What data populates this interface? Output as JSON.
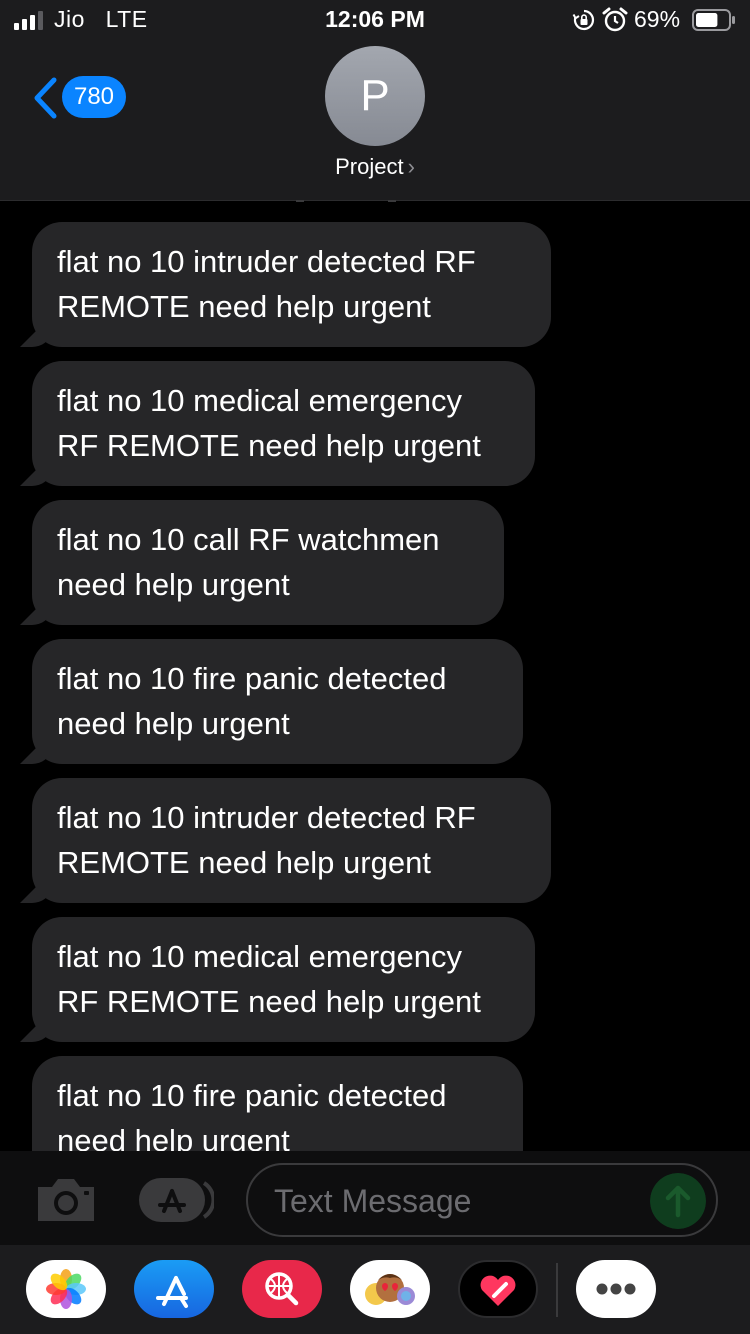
{
  "status_bar": {
    "carrier": "Jio",
    "network": "LTE",
    "time": "12:06 PM",
    "battery_percent": "69%",
    "battery_level": 0.69,
    "icons": [
      "signal-bars-icon",
      "rotation-lock-icon",
      "alarm-icon",
      "battery-icon"
    ]
  },
  "header": {
    "back_count": "780",
    "avatar_initial": "P",
    "contact_name": "Project",
    "chevron": "›"
  },
  "messages": [
    {
      "line1": "flat no 10 intruder detected RF",
      "line2": "REMOTE need help urgent"
    },
    {
      "line1": "flat no 10 medical emergency",
      "line2": "RF REMOTE need help urgent"
    },
    {
      "line1": "flat no 10 call RF watchmen",
      "line2": "need help urgent"
    },
    {
      "line1": "flat no 10 fire panic detected",
      "line2": "need help urgent"
    },
    {
      "line1": "flat no 10 intruder detected RF",
      "line2": "REMOTE need help urgent"
    },
    {
      "line1": "flat no 10 medical emergency",
      "line2": "RF REMOTE need help urgent"
    },
    {
      "line1": "flat no 10 fire panic detected",
      "line2": "need help urgent"
    }
  ],
  "input": {
    "placeholder": "Text Message"
  },
  "drawer": {
    "apps": [
      "photos-icon",
      "app-store-icon",
      "web-search-icon",
      "memoji-icon",
      "digital-touch-icon",
      "more-icon"
    ]
  },
  "colors": {
    "accent": "#0a84ff",
    "bubble": "#262628",
    "background": "#000000",
    "send_disabled": "#0f3d1e"
  }
}
